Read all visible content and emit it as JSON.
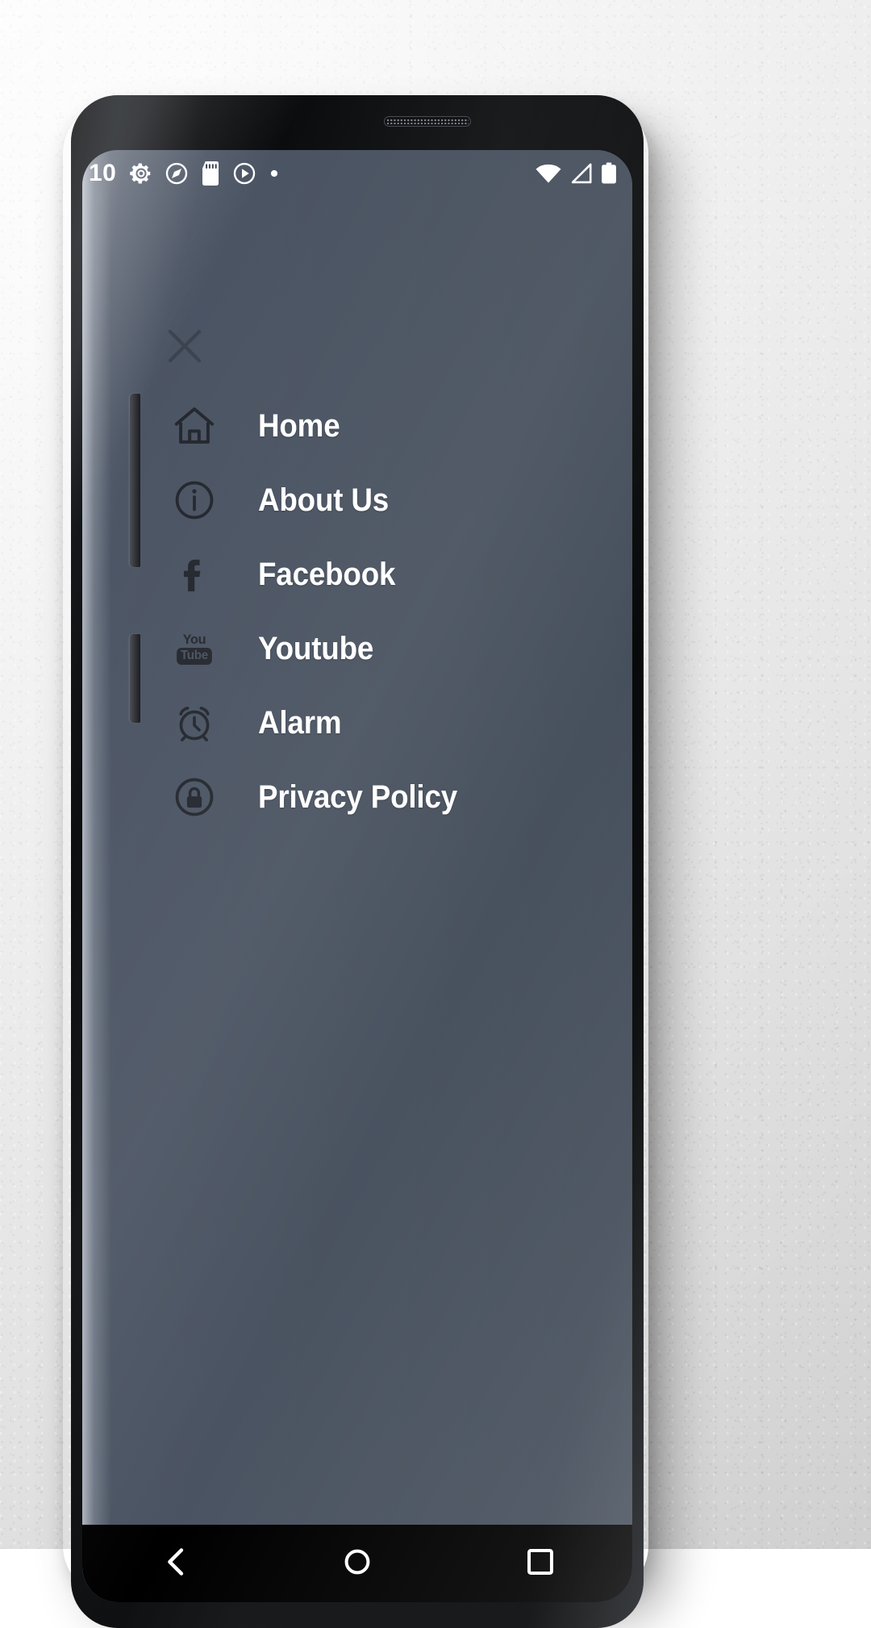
{
  "status_bar": {
    "time": "10",
    "left_icons": [
      "gear-icon",
      "compass-icon",
      "sd-card-icon",
      "play-circle-icon",
      "dot-icon"
    ],
    "right_icons": [
      "wifi-icon",
      "signal-icon",
      "battery-icon"
    ]
  },
  "drawer": {
    "close_label": "close-icon",
    "items": [
      {
        "label": "Home",
        "icon": "home-icon"
      },
      {
        "label": "About Us",
        "icon": "info-icon"
      },
      {
        "label": "Facebook",
        "icon": "facebook-icon"
      },
      {
        "label": "Youtube",
        "icon": "youtube-icon"
      },
      {
        "label": "Alarm",
        "icon": "alarm-clock-icon"
      },
      {
        "label": "Privacy Policy",
        "icon": "lock-icon"
      }
    ]
  },
  "youtube_icon_text": {
    "top": "You",
    "bottom": "Tube"
  },
  "navigation_bar": {
    "buttons": [
      "recents-button",
      "home-button",
      "back-button"
    ]
  },
  "colors": {
    "drawer_background": "#49525f",
    "drawer_edge_highlight": "#7c8492",
    "label_text": "#ffffff",
    "icon_dark": "#24282e",
    "bezel": "#0b0c0e",
    "wall": "#f1f1f1"
  }
}
